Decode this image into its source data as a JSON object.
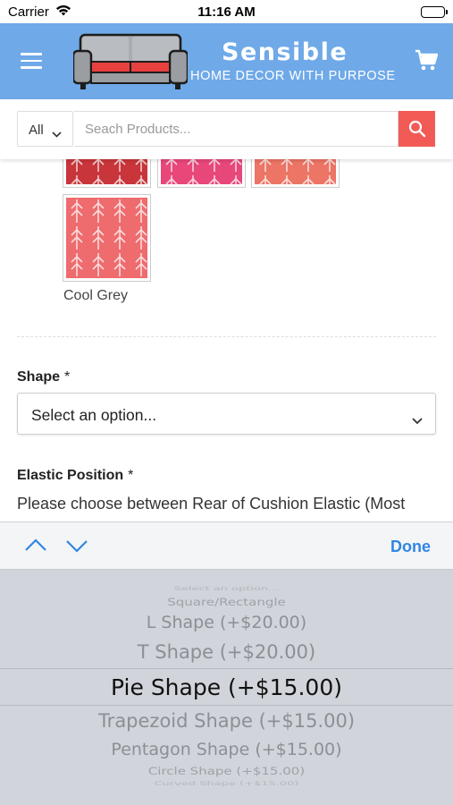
{
  "status_bar": {
    "carrier": "Carrier",
    "time": "11:16 AM"
  },
  "header": {
    "brand_name": "Sensible",
    "tagline": "HOME DECOR WITH PURPOSE",
    "bg_color": "#6fa9e8",
    "icons": [
      "hamburger-menu-icon",
      "sofa-logo",
      "shopping-cart-icon"
    ]
  },
  "search": {
    "category_value": "All",
    "placeholder": "Seach Products...",
    "button_color": "#f25a55"
  },
  "product": {
    "swatch_color_name": "Cool Grey",
    "swatch_colors": [
      "#c8353a",
      "#e8477a",
      "#ec7566",
      "#ee6b6e"
    ]
  },
  "shape_field": {
    "label": "Shape",
    "required_mark": "*",
    "selected_value": "Select an option..."
  },
  "elastic_field": {
    "label": "Elastic Position",
    "required_mark": "*",
    "help_text": "Please choose between Rear of Cushion Elastic (Most"
  },
  "picker": {
    "done_label": "Done",
    "accent_color": "#2f86e3",
    "options": [
      "Select an option...",
      "Square/Rectangle",
      "L Shape (+$20.00)",
      "T Shape (+$20.00)",
      "Pie Shape (+$15.00)",
      "Trapezoid Shape (+$15.00)",
      "Pentagon Shape (+$15.00)",
      "Circle Shape (+$15.00)",
      "Curved Shape (+$15.00)"
    ],
    "selected_option": "Pie Shape (+$15.00)"
  }
}
